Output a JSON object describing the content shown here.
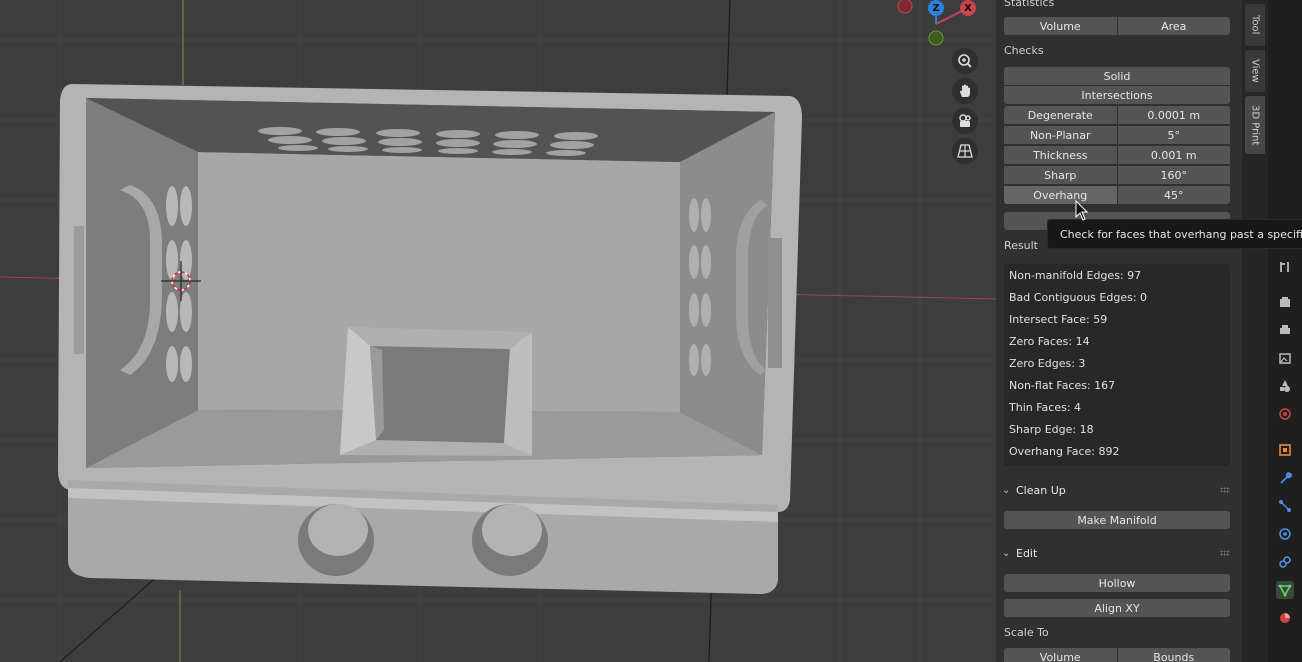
{
  "sidebar": {
    "statistics_label": "Statistics",
    "statistics_buttons": [
      "Volume",
      "Area"
    ],
    "checks_label": "Checks",
    "check_solid": "Solid",
    "check_intersections": "Intersections",
    "checks": [
      {
        "label": "Degenerate",
        "value": "0.0001 m"
      },
      {
        "label": "Non-Planar",
        "value": "5°"
      },
      {
        "label": "Thickness",
        "value": "0.001 m"
      },
      {
        "label": "Sharp",
        "value": "160°"
      },
      {
        "label": "Overhang",
        "value": "45°"
      }
    ],
    "result_label": "Result",
    "results": [
      "Non-manifold Edges: 97",
      "Bad Contiguous Edges: 0",
      "Intersect Face: 59",
      "Zero Faces: 14",
      "Zero Edges: 3",
      "Non-flat Faces: 167",
      "Thin Faces: 4",
      "Sharp Edge: 18",
      "Overhang Face: 892"
    ],
    "cleanup_label": "Clean Up",
    "make_manifold": "Make Manifold",
    "edit_label": "Edit",
    "hollow": "Hollow",
    "align_xy": "Align XY",
    "scale_to_label": "Scale To",
    "scale_to_buttons": [
      "Volume",
      "Bounds"
    ]
  },
  "tabs": [
    "Tool",
    "View",
    "3D Print"
  ],
  "active_tab": "3D Print",
  "tooltip": "Check for faces that overhang past a specified angle",
  "gizmo": {
    "z": "Z",
    "x": "X"
  },
  "colors": {
    "accent_green": "#6bd36b",
    "axis_red": "#c8434c",
    "axis_blue": "#2f7fe0",
    "axis_green": "#6a9a33"
  }
}
